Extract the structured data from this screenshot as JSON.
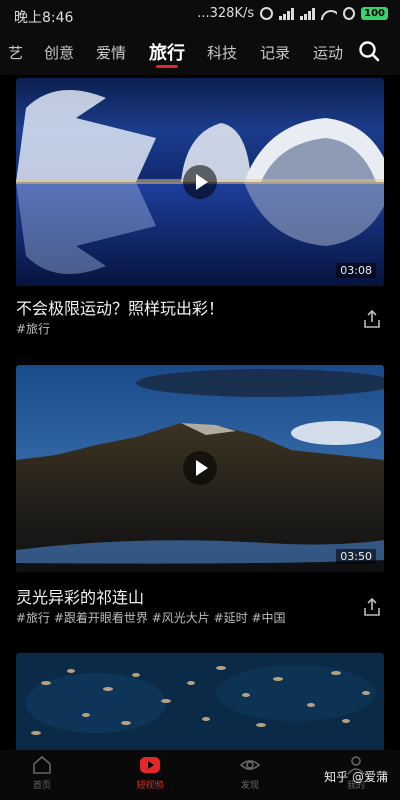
{
  "status_bar": {
    "time": "晚上8:46",
    "speed": "...328K/s",
    "battery": "100"
  },
  "tabs": {
    "items": [
      "艺",
      "创意",
      "爱情",
      "旅行",
      "科技",
      "记录",
      "运动"
    ],
    "active": "旅行"
  },
  "feed": {
    "cards": [
      {
        "title": "不会极限运动？照样玩出彩！",
        "tags": "#旅行",
        "duration": "03:08"
      },
      {
        "title": "灵光异彩的祁连山",
        "tags": "#旅行 #跟着开眼看世界 #风光大片 #延时 #中国",
        "duration": "03:50"
      }
    ]
  },
  "bottom_nav": {
    "items": [
      "首页",
      "短视频",
      "发现",
      "我的"
    ],
    "active": "短视频",
    "watermark": "知乎 @爱蒲"
  },
  "colors": {
    "accent": "#e5262b",
    "background": "#000000",
    "battery": "#3bd16f"
  }
}
